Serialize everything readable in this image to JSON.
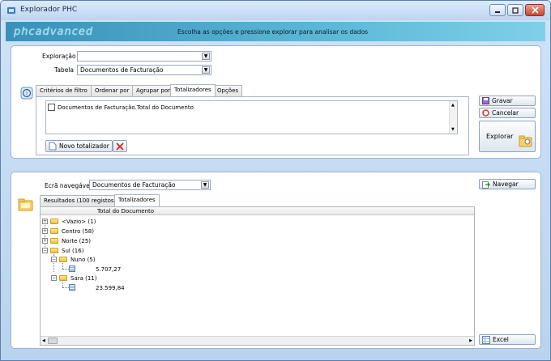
{
  "window": {
    "title": "Explorador PHC"
  },
  "banner": {
    "logo": "phcadvanced",
    "text": "Escolha as opções e pressione explorar para analisar os dados"
  },
  "top": {
    "exploracao_label": "Exploração",
    "exploracao_value": "",
    "tabela_label": "Tabela",
    "tabela_value": "Documentos de Facturação",
    "tabs": [
      "Critérios de filtro",
      "Ordenar por",
      "Agrupar por",
      "Totalizadores",
      "Opções"
    ],
    "totalizer_item": "Documentos de Facturação.Total do Documento",
    "novo_totalizador": "Novo totalizador",
    "gravar": "Gravar",
    "cancelar": "Cancelar",
    "explorar": "Explorar"
  },
  "bottom": {
    "ecra_label": "Ecrã navegável",
    "ecra_value": "Documentos de Facturação",
    "navegar": "Navegar",
    "tabs": [
      "Resultados (100 registos)",
      "Totalizadores"
    ],
    "column_header": "Total do Documento",
    "tree": {
      "vazio": "<Vazio> (1)",
      "centro": "Centro (58)",
      "norte": "Norte (25)",
      "sul": "Sul (16)",
      "nuno": "Nuno (5)",
      "nuno_value": "5.707,27",
      "sara": "Sara (11)",
      "sara_value": "23.599,84"
    },
    "excel": "Excel"
  }
}
